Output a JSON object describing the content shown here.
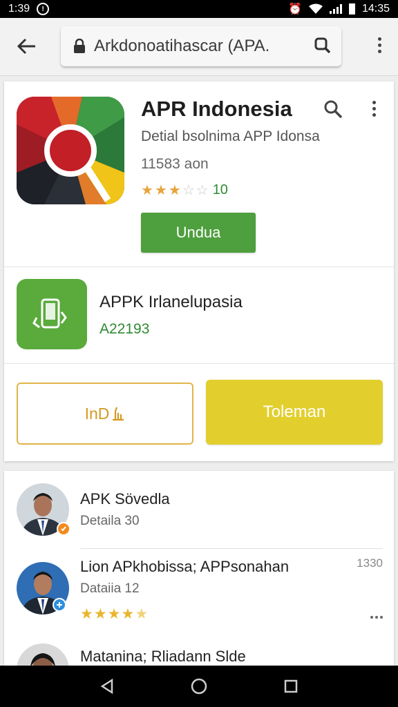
{
  "status_bar": {
    "time_left": "1:39",
    "time_right": "14:35"
  },
  "browser": {
    "url": "Arkdonoatihascar (APA."
  },
  "app": {
    "title": "APR Indonesia",
    "subtitle": "Detial bsolnima APP Idonsa",
    "size": "11583 aon",
    "rating_stars": 3,
    "rating_max": 5,
    "rating_count": "10",
    "install_label": "Undua"
  },
  "sub_app": {
    "title": "APPK Irlanelupasia",
    "code": "A22193"
  },
  "actions": {
    "outline_label": "InD",
    "yellow_label": "Toleman"
  },
  "reviews": [
    {
      "name": "APK Sövedla",
      "detail": "Detaila 30",
      "badge_color": "#f28a1c"
    },
    {
      "name": "Lion APkhobissa; APPsonahan",
      "detail": "Dataiia 12",
      "time": "1330",
      "stars": 4.5,
      "badge_color": "#2b8fe0"
    },
    {
      "name": "Matanina; Rliadann Slde"
    }
  ],
  "colors": {
    "install_green": "#4e9f3d",
    "accent_yellow": "#e2cf2e",
    "rating_green": "#2f8a32"
  }
}
